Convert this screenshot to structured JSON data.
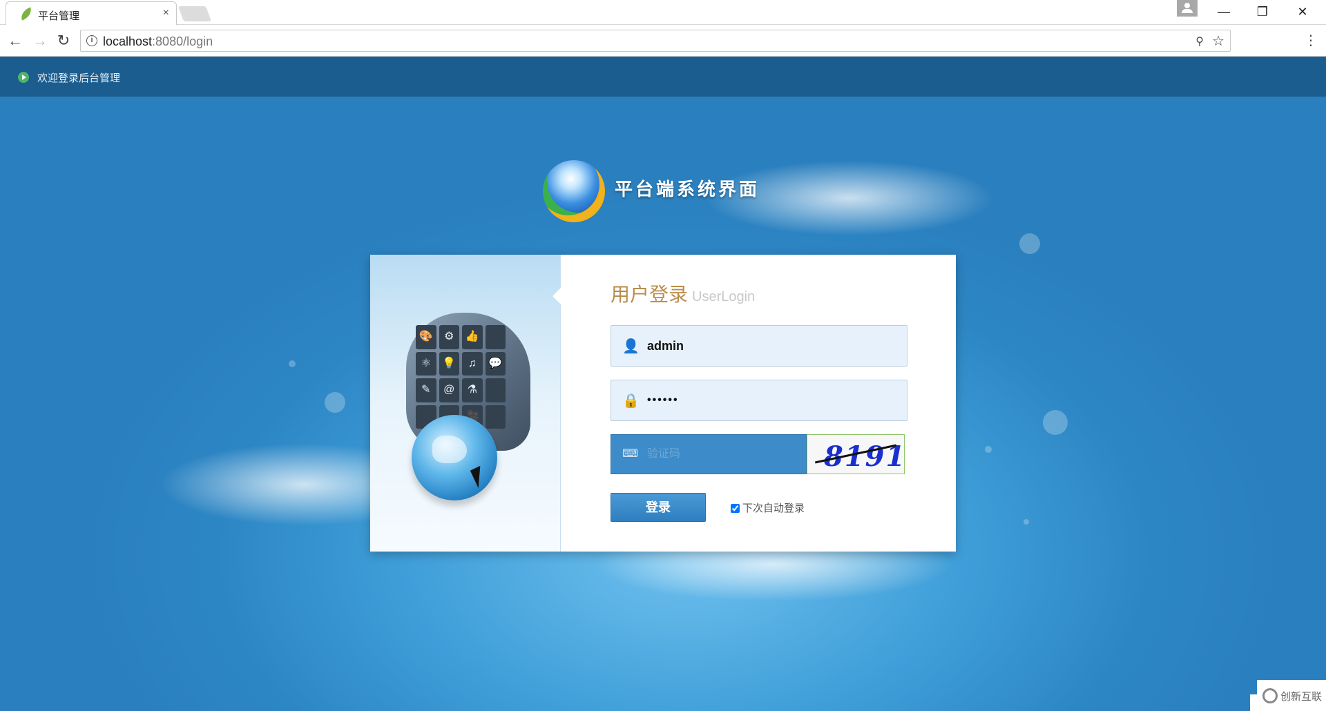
{
  "browser": {
    "tab_title": "平台管理",
    "tab_close": "×",
    "url_host": "localhost",
    "url_path": ":8080/login",
    "back": "←",
    "forward": "→",
    "reload": "↻",
    "minimize": "—",
    "restore": "❐",
    "close": "✕",
    "menu": "⋮",
    "star": "☆",
    "key": "⚲",
    "info": "i"
  },
  "page": {
    "welcome": "欢迎登录后台管理",
    "system_title": "平台端系统界面",
    "login": {
      "title_cn": "用户登录",
      "title_en": "UserLogin",
      "username_value": "admin",
      "password_value": "••••••",
      "captcha_placeholder": "验证码",
      "captcha_image_text": "8191",
      "submit_label": "登录",
      "remember_label": "下次自动登录"
    },
    "head_icons": [
      "🎨",
      "⚙",
      "👍",
      "",
      "⚛",
      "💡",
      "♫",
      "💬",
      "✎",
      "@",
      "⚗",
      "",
      "",
      "",
      "🎥",
      ""
    ]
  },
  "watermark": {
    "text": "创新互联"
  },
  "colors": {
    "topbar": "#1b5d8e",
    "accent": "#3d8bc8",
    "title_gold": "#b98c4b"
  }
}
